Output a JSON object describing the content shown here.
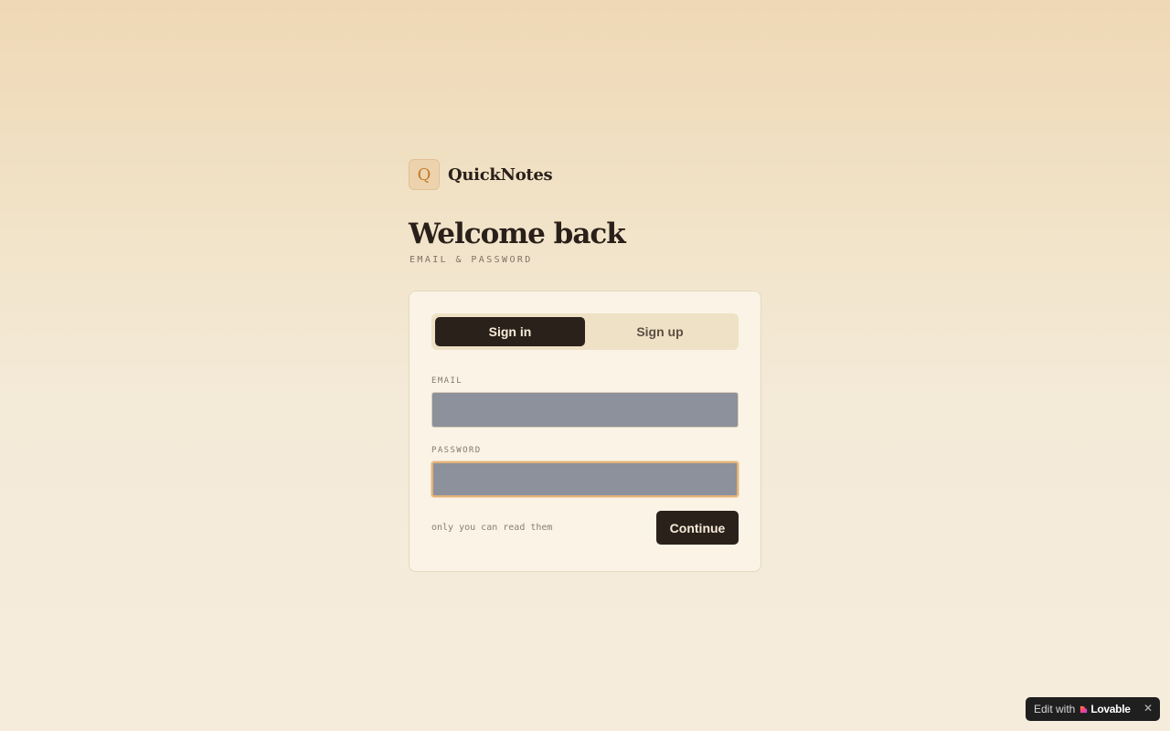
{
  "brand": {
    "logo_letter": "Q",
    "name": "QuickNotes"
  },
  "heading": {
    "title": "Welcome back",
    "subtitle": "EMAIL & PASSWORD"
  },
  "auth_card": {
    "tabs": [
      {
        "label": "Sign in",
        "active": true
      },
      {
        "label": "Sign up",
        "active": false
      }
    ],
    "email": {
      "label": "EMAIL",
      "value": "",
      "placeholder": ""
    },
    "password": {
      "label": "PASSWORD",
      "value": "",
      "placeholder": ""
    },
    "hint": "only you can read them",
    "continue_label": "Continue"
  },
  "badge": {
    "prefix": "Edit with",
    "name": "Lovable",
    "close_icon": "close-icon",
    "logo_icon": "lovable-heart-icon"
  },
  "colors": {
    "accent_dark": "#2b211b",
    "logo_orange": "#c27a2c",
    "focus_ring": "#e3b27a"
  }
}
